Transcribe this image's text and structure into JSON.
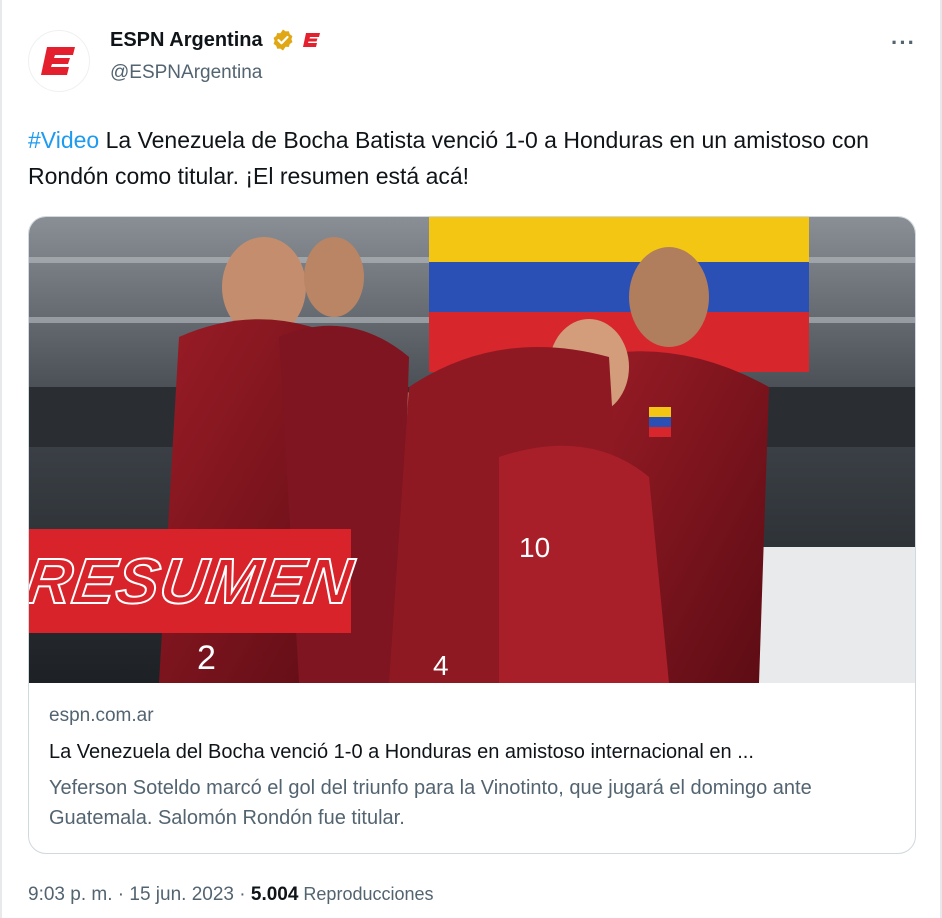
{
  "author": {
    "name": "ESPN Argentina",
    "handle": "@ESPNArgentina",
    "verified_color": "#e0a814",
    "brand_color": "#e5202e"
  },
  "tweet": {
    "hashtag": "#Video",
    "text": " La Venezuela de Bocha Batista venció 1-0 a Honduras en un amistoso con Rondón como titular. ¡El resumen está acá!"
  },
  "media": {
    "overlay_label": "RESUMEN",
    "jersey_numbers": [
      "2",
      "10",
      "4"
    ]
  },
  "link_card": {
    "domain": "espn.com.ar",
    "title": "La Venezuela del Bocha venció 1-0 a Honduras en amistoso internacional en ...",
    "description": "Yeferson Soteldo marcó el gol del triunfo para la Vinotinto, que jugará el domingo ante Guatemala. Salomón Rondón fue titular."
  },
  "meta": {
    "time": "9:03 p. m.",
    "sep1": " · ",
    "date": "15 jun. 2023",
    "sep2": " · ",
    "views": "5.004",
    "views_label": " Reproducciones"
  },
  "icons": {
    "avatar": "espn-e-logo-icon",
    "verified": "verified-badge-icon",
    "affiliate": "espn-affiliate-icon",
    "more": "more-options-icon"
  },
  "more_glyph": "···"
}
